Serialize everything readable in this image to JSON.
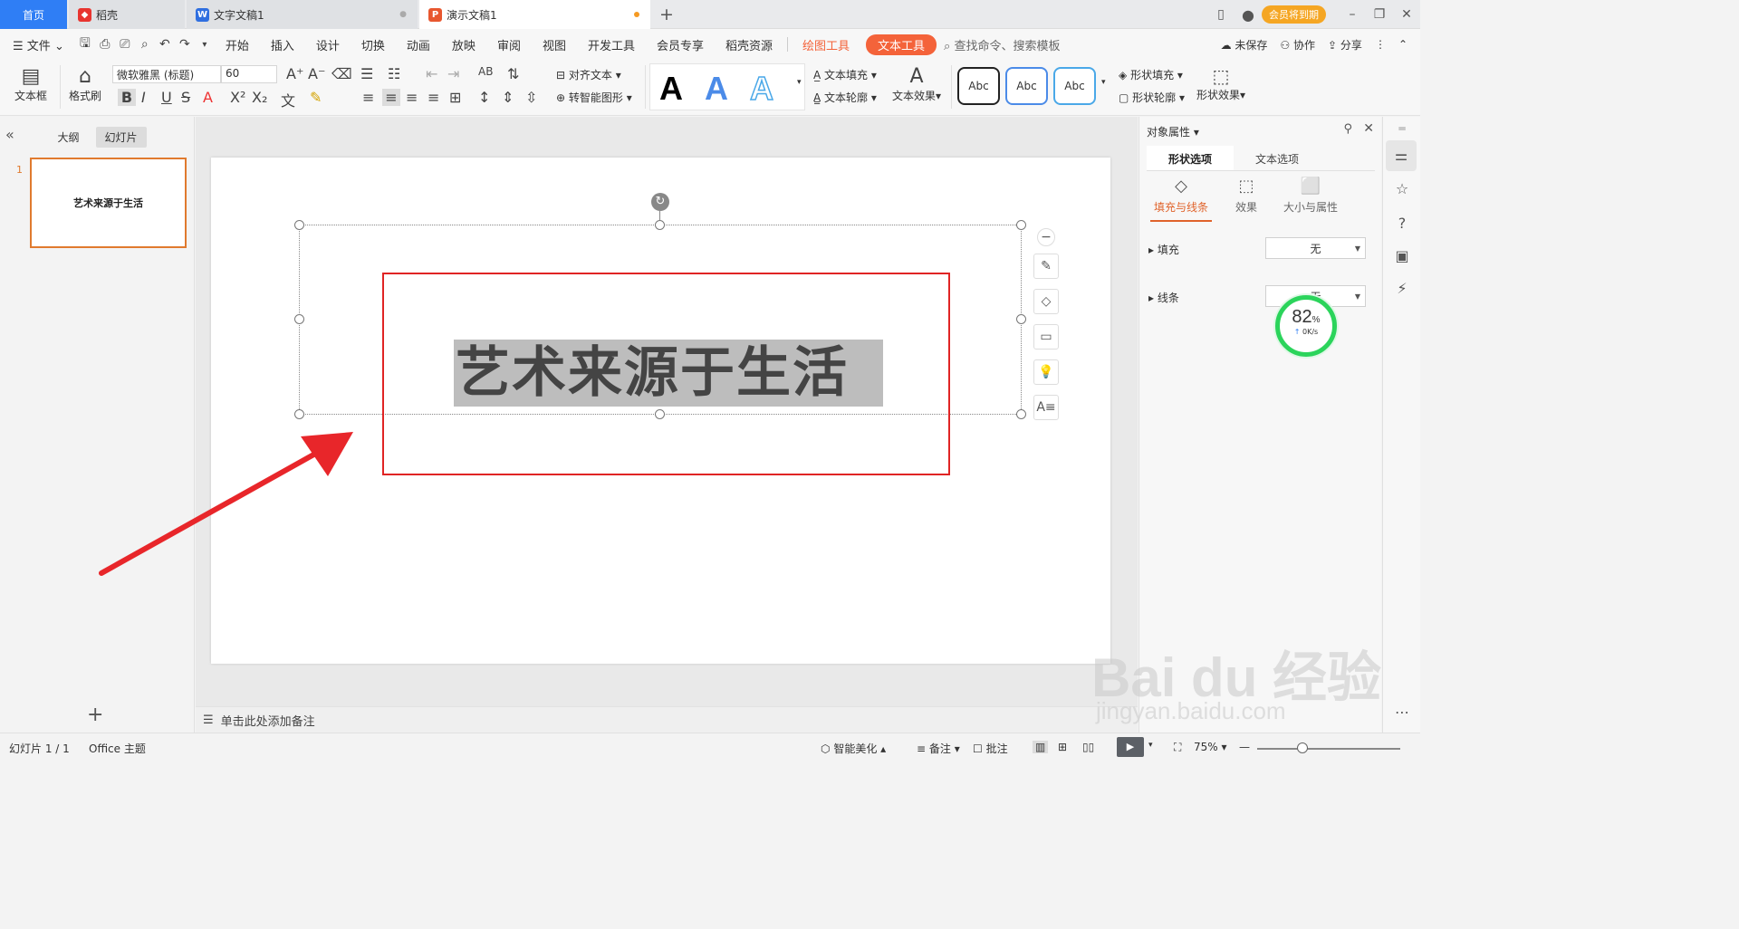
{
  "titlebar": {
    "tabs": [
      {
        "label": "首页"
      },
      {
        "label": "稻壳"
      },
      {
        "label": "文字文稿1"
      },
      {
        "label": "演示文稿1"
      }
    ],
    "member_label": "会员将到期"
  },
  "menubar": {
    "file": "文件",
    "items": [
      "开始",
      "插入",
      "设计",
      "切换",
      "动画",
      "放映",
      "审阅",
      "视图",
      "开发工具",
      "会员专享",
      "稻壳资源"
    ],
    "drawing_tools": "绘图工具",
    "text_tools": "文本工具",
    "search_placeholder": "查找命令、搜索模板",
    "unsaved": "未保存",
    "collab": "协作",
    "share": "分享"
  },
  "ribbon": {
    "textbox": "文本框",
    "format_painter": "格式刷",
    "font_name": "微软雅黑 (标题)",
    "font_size": "60",
    "align_text": "对齐文本",
    "smartart": "转智能图形",
    "text_fill": "文本填充",
    "text_outline": "文本轮廓",
    "text_effect": "文本效果",
    "style_samples": [
      "A",
      "A",
      "A"
    ],
    "shape_samples": [
      "Abc",
      "Abc",
      "Abc"
    ],
    "shape_fill": "形状填充",
    "shape_outline": "形状轮廓",
    "shape_effect": "形状效果"
  },
  "leftpanel": {
    "tab_outline": "大纲",
    "tab_slides": "幻灯片",
    "slide_number": "1",
    "thumb_text": "艺术来源于生活"
  },
  "slide": {
    "title": "艺术来源于生活"
  },
  "notes": {
    "placeholder": "单击此处添加备注"
  },
  "rightpanel": {
    "title": "对象属性",
    "tab_shape": "形状选项",
    "tab_text": "文本选项",
    "sub_fill_line": "填充与线条",
    "sub_effect": "效果",
    "sub_size": "大小与属性",
    "fill_label": "填充",
    "fill_value": "无",
    "line_label": "线条",
    "line_value": "无"
  },
  "speed": {
    "percent": "82",
    "unit": "%",
    "rate": "0K/s"
  },
  "statusbar": {
    "slide_info": "幻灯片 1 / 1",
    "theme": "Office 主题",
    "beautify": "智能美化",
    "notes": "备注",
    "comments": "批注",
    "zoom": "75%"
  },
  "watermark": {
    "text": "Bai du 经验",
    "sub": "jingyan.baidu.com"
  },
  "colors": {
    "accent_blue": "#2f7ef5",
    "text_tools_orange": "#f4633a",
    "selection_red": "#e02424"
  }
}
